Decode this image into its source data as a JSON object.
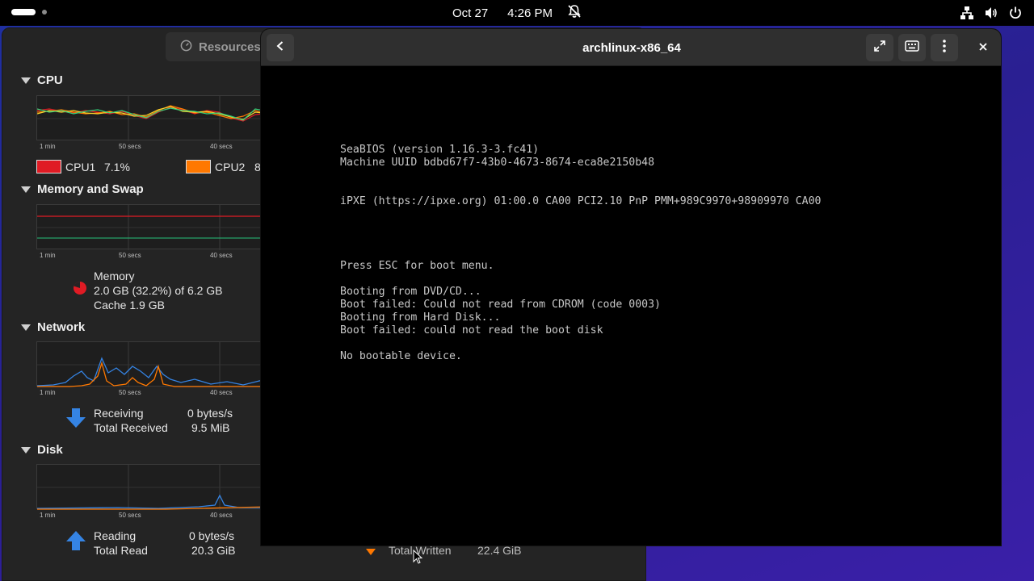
{
  "topbar": {
    "date": "Oct 27",
    "time": "4:26 PM"
  },
  "resources": {
    "title": "Resources",
    "sections": {
      "cpu": {
        "heading": "CPU",
        "ticks": [
          "1 min",
          "50 secs",
          "40 secs"
        ],
        "legend": [
          {
            "name": "CPU1",
            "value": "7.1%",
            "color": "#e01b24"
          },
          {
            "name": "CPU2",
            "value": "8",
            "color": "#ff7800"
          }
        ]
      },
      "memory": {
        "heading": "Memory and Swap",
        "ticks": [
          "1 min",
          "50 secs",
          "40 secs"
        ],
        "title": "Memory",
        "usage": "2.0 GB (32.2%) of 6.2 GB",
        "cache": "Cache 1.9 GB"
      },
      "network": {
        "heading": "Network",
        "ticks": [
          "1 min",
          "50 secs",
          "40 secs"
        ],
        "receiving_label": "Receiving",
        "receiving_value": "0 bytes/s",
        "total_received_label": "Total Received",
        "total_received_value": "9.5 MiB"
      },
      "disk": {
        "heading": "Disk",
        "ticks": [
          "1 min",
          "50 secs",
          "40 secs"
        ],
        "reading_label": "Reading",
        "reading_value": "0 bytes/s",
        "total_read_label": "Total Read",
        "total_read_value": "20.3 GiB",
        "total_written_label": "Total Written",
        "total_written_value": "22.4 GiB"
      }
    }
  },
  "vm": {
    "title": "archlinux-x86_64",
    "console": [
      "SeaBIOS (version 1.16.3-3.fc41)",
      "Machine UUID bdbd67f7-43b0-4673-8674-eca8e2150b48",
      "",
      "",
      "iPXE (https://ipxe.org) 01:00.0 CA00 PCI2.10 PnP PMM+989C9970+98909970 CA00",
      "",
      "",
      "",
      "",
      "Press ESC for boot menu.",
      "",
      "Booting from DVD/CD...",
      "Boot failed: Could not read from CDROM (code 0003)",
      "Booting from Hard Disk...",
      "Boot failed: could not read the boot disk",
      "",
      "No bootable device."
    ]
  },
  "icons": {
    "network_status": "network-wired-icon",
    "volume": "speaker-icon",
    "power": "power-icon",
    "notifications": "bell-muted-icon"
  }
}
